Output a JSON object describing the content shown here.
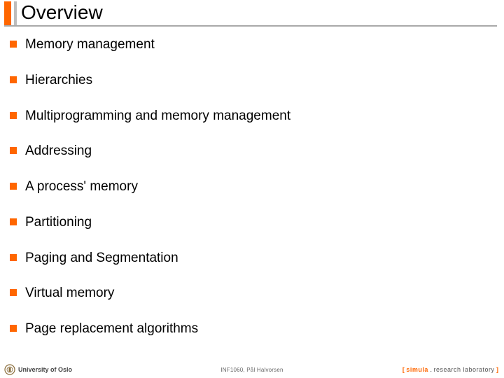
{
  "title": "Overview",
  "items": [
    "Memory management",
    "Hierarchies",
    "Multiprogramming and memory management",
    "Addressing",
    "A process' memory",
    "Partitioning",
    "Paging and Segmentation",
    "Virtual memory",
    "Page replacement algorithms"
  ],
  "footer": {
    "left": "University of Oslo",
    "center": "INF1060,   Pål Halvorsen",
    "right_bracket_open": "[ ",
    "right_simula": "simula",
    "right_dot": " . ",
    "right_lab": "research laboratory",
    "right_bracket_close": " ]"
  }
}
